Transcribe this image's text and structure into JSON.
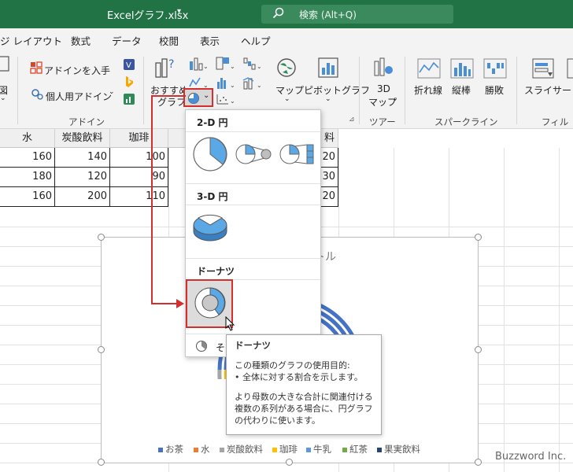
{
  "titlebar": {
    "file_name": "Excelグラフ.xlsx",
    "search_placeholder": "検索 (Alt+Q)"
  },
  "menu": {
    "tabs": [
      "ジ レイアウト",
      "数式",
      "データ",
      "校閲",
      "表示",
      "ヘルプ"
    ]
  },
  "ribbon": {
    "addin_get": "アドインを入手",
    "addin_personal": "個人用アドイン",
    "addin_group": "アドイン",
    "left_cut_label": "図",
    "recommended_line1": "おすすめ",
    "recommended_line2": "グラフ",
    "map": "マップ",
    "pivot_chart": "ピボットグラフ",
    "map3d_line1": "3D",
    "map3d_line2": "マップ",
    "tour_group": "ツアー",
    "spark_line": "折れ線",
    "spark_column": "縦棒",
    "spark_winloss": "勝敗",
    "sparkline_group": "スパークライン",
    "slicer": "スライサー",
    "filter_group": "フィルター"
  },
  "sheet": {
    "headers": [
      "水",
      "炭酸飲料",
      "珈琲",
      "料"
    ],
    "rows": [
      [
        "160",
        "140",
        "100",
        "20"
      ],
      [
        "180",
        "120",
        "90",
        "30"
      ],
      [
        "160",
        "200",
        "110",
        "20"
      ]
    ]
  },
  "chart": {
    "title_fragment": "トル",
    "legend": [
      {
        "name": "お茶",
        "color": "#4472c4"
      },
      {
        "name": "水",
        "color": "#ed7d31"
      },
      {
        "name": "炭酸飲料",
        "color": "#a5a5a5"
      },
      {
        "name": "珈琲",
        "color": "#ffc000"
      },
      {
        "name": "牛乳",
        "color": "#5b9bd5"
      },
      {
        "name": "紅茶",
        "color": "#70ad47"
      },
      {
        "name": "果実飲料",
        "color": "#264478"
      }
    ]
  },
  "dropdown": {
    "section_2d": "2-D 円",
    "section_3d": "3-D 円",
    "section_donut": "ドーナツ",
    "more_label": "その"
  },
  "tooltip": {
    "title": "ドーナツ",
    "line1": "この種類のグラフの使用目的:",
    "line2": "• 全体に対する割合を示します。",
    "line3": "より母数の大きな合計に関連付ける",
    "line4": "複数の系列がある場合に、円グラフ",
    "line5": "の代わりに使います。"
  },
  "watermark": "Buzzword Inc."
}
